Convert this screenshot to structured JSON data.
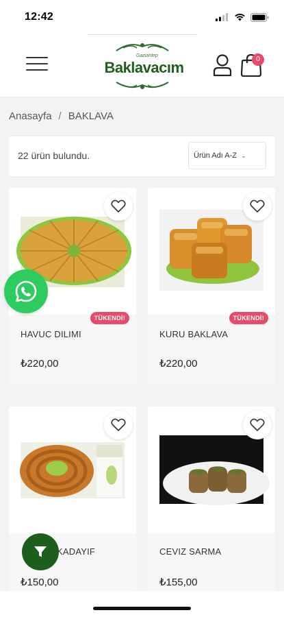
{
  "status_bar": {
    "time": "12:42"
  },
  "header": {
    "logo_sub": "Gaziantep",
    "logo_title": "Baklavacım",
    "cart_count": "0"
  },
  "breadcrumb": {
    "home": "Anasayfa",
    "separator": "/",
    "current": "BAKLAVA"
  },
  "results": {
    "count_text": "22 ürün bulundu.",
    "sort_selected": "Ürün Adı A-Z"
  },
  "products": [
    {
      "name": "HAVUC DILIMI",
      "price": "₺220,00",
      "badge": "TÜKENDİ!"
    },
    {
      "name": "KURU BAKLAVA",
      "price": "₺220,00",
      "badge": "TÜKENDİ!"
    },
    {
      "name": "KADAYIF",
      "price": "₺150,00",
      "badge": ""
    },
    {
      "name": "CEVIZ SARMA",
      "price": "₺155,00",
      "badge": ""
    }
  ],
  "colors": {
    "brand_green": "#1d5e1d",
    "badge_pink": "#e84a6c",
    "whatsapp_green": "#2ecc60",
    "page_bg": "#f3f3f5"
  },
  "icons": {
    "menu": "hamburger-icon",
    "user": "user-icon",
    "cart": "shopping-bag-icon",
    "favorite": "heart-icon",
    "whatsapp": "whatsapp-icon",
    "filter": "filter-icon"
  }
}
